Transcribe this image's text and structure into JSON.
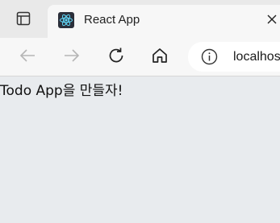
{
  "browser": {
    "tab": {
      "title": "React App",
      "favicon": "react-logo-icon"
    },
    "address_bar": {
      "url": "localhost"
    },
    "toolbar": {
      "back": "back-arrow-icon",
      "forward": "forward-arrow-icon",
      "reload": "reload-icon",
      "home": "home-icon",
      "info": "info-icon"
    }
  },
  "page": {
    "heading": "Todo App을 만들자!"
  },
  "colors": {
    "page_background": "#e8ebee",
    "tabstrip_background": "#e9e9e9",
    "toolbar_background": "#f7f7f7",
    "react_logo": "#61dafb"
  }
}
